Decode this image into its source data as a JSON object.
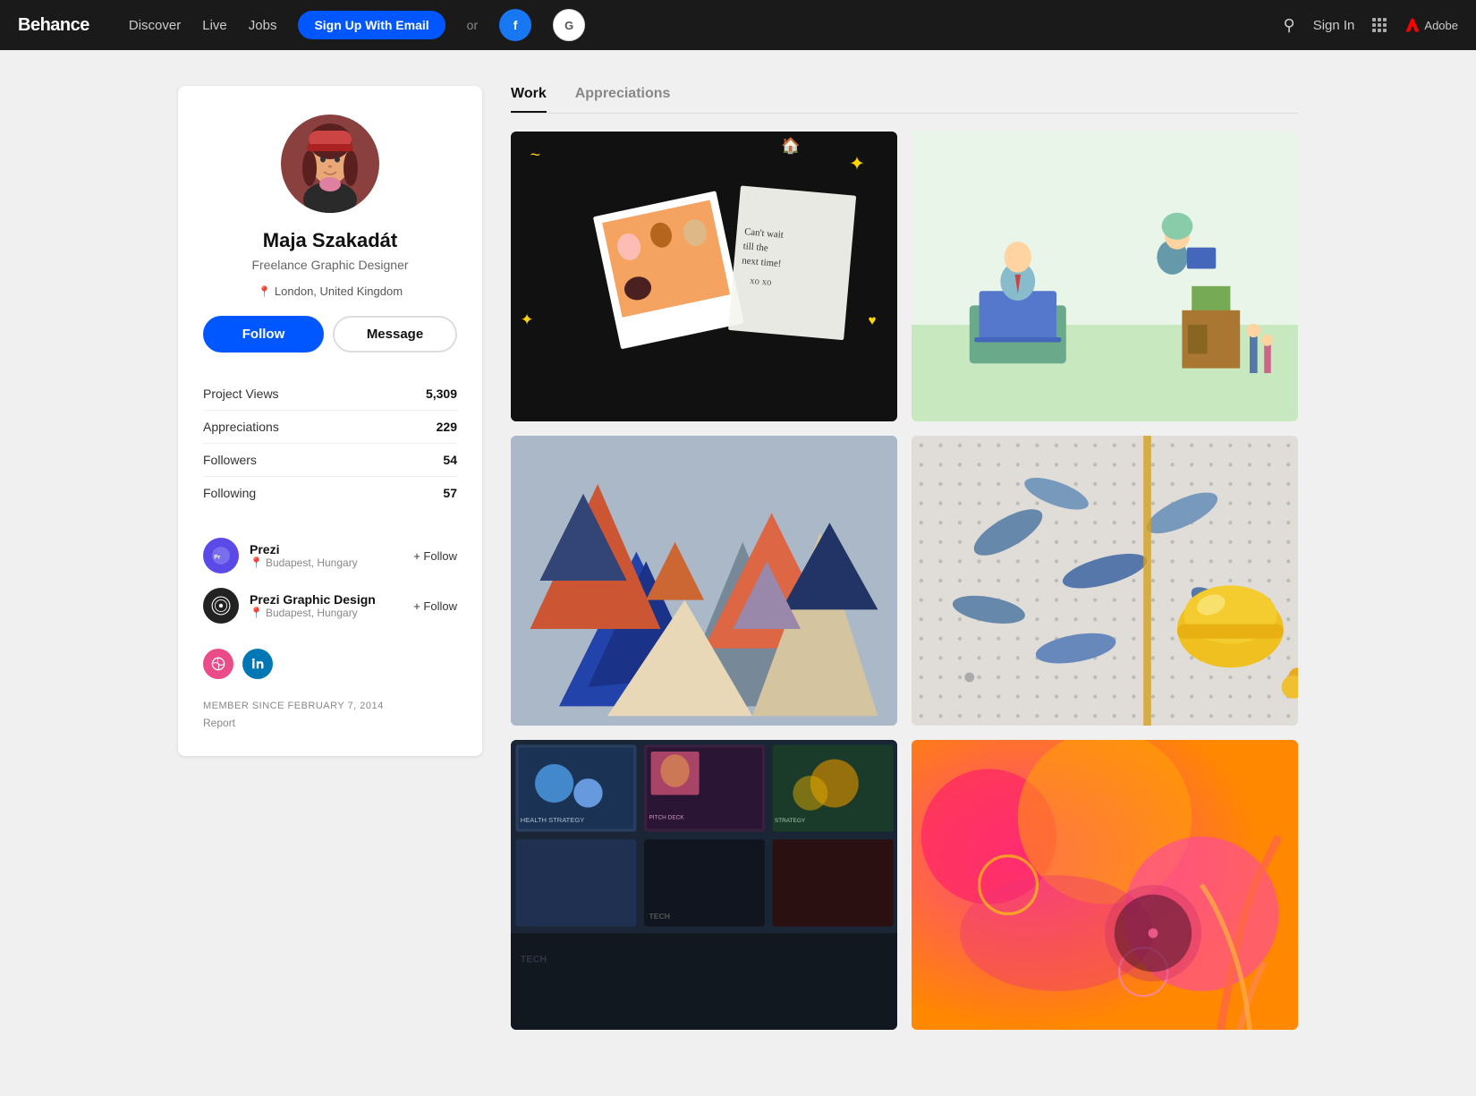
{
  "site": {
    "logo": "Behance"
  },
  "navbar": {
    "discover": "Discover",
    "live": "Live",
    "jobs": "Jobs",
    "signup_btn": "Sign Up With Email",
    "or_text": "or",
    "facebook_letter": "f",
    "google_letter": "G",
    "signin_link": "Sign In",
    "adobe_text": "Adobe"
  },
  "profile": {
    "name": "Maja Szakadát",
    "title": "Freelance Graphic Designer",
    "location": "London, United Kingdom",
    "follow_btn": "Follow",
    "message_btn": "Message",
    "stats": [
      {
        "label": "Project Views",
        "value": "5,309"
      },
      {
        "label": "Appreciations",
        "value": "229"
      },
      {
        "label": "Followers",
        "value": "54"
      },
      {
        "label": "Following",
        "value": "57"
      }
    ],
    "companies": [
      {
        "id": "prezi",
        "name": "Prezi",
        "location": "Budapest, Hungary",
        "follow": "+ Follow"
      },
      {
        "id": "prezi-gd",
        "name": "Prezi Graphic Design",
        "location": "Budapest, Hungary",
        "follow": "+ Follow"
      }
    ],
    "social": {
      "dribbble_title": "Dribbble",
      "linkedin_title": "LinkedIn"
    },
    "member_since": "MEMBER SINCE FEBRUARY 7, 2014",
    "report": "Report"
  },
  "tabs": {
    "work": "Work",
    "appreciations": "Appreciations"
  },
  "projects": [
    {
      "id": "proj1",
      "alt": "Friends Illustration Collage",
      "style": "polaroid-collage"
    },
    {
      "id": "proj2",
      "alt": "Work From Home Illustration",
      "style": "illustration"
    },
    {
      "id": "proj3",
      "alt": "Triangle Geometry Art",
      "style": "triangles"
    },
    {
      "id": "proj4",
      "alt": "Blue Leaves Hardhat Still Life",
      "style": "hardhat"
    },
    {
      "id": "proj5",
      "alt": "Prezi Presentation Slides",
      "style": "slides"
    },
    {
      "id": "proj6",
      "alt": "Colorful Abstract Art",
      "style": "abstract"
    }
  ]
}
